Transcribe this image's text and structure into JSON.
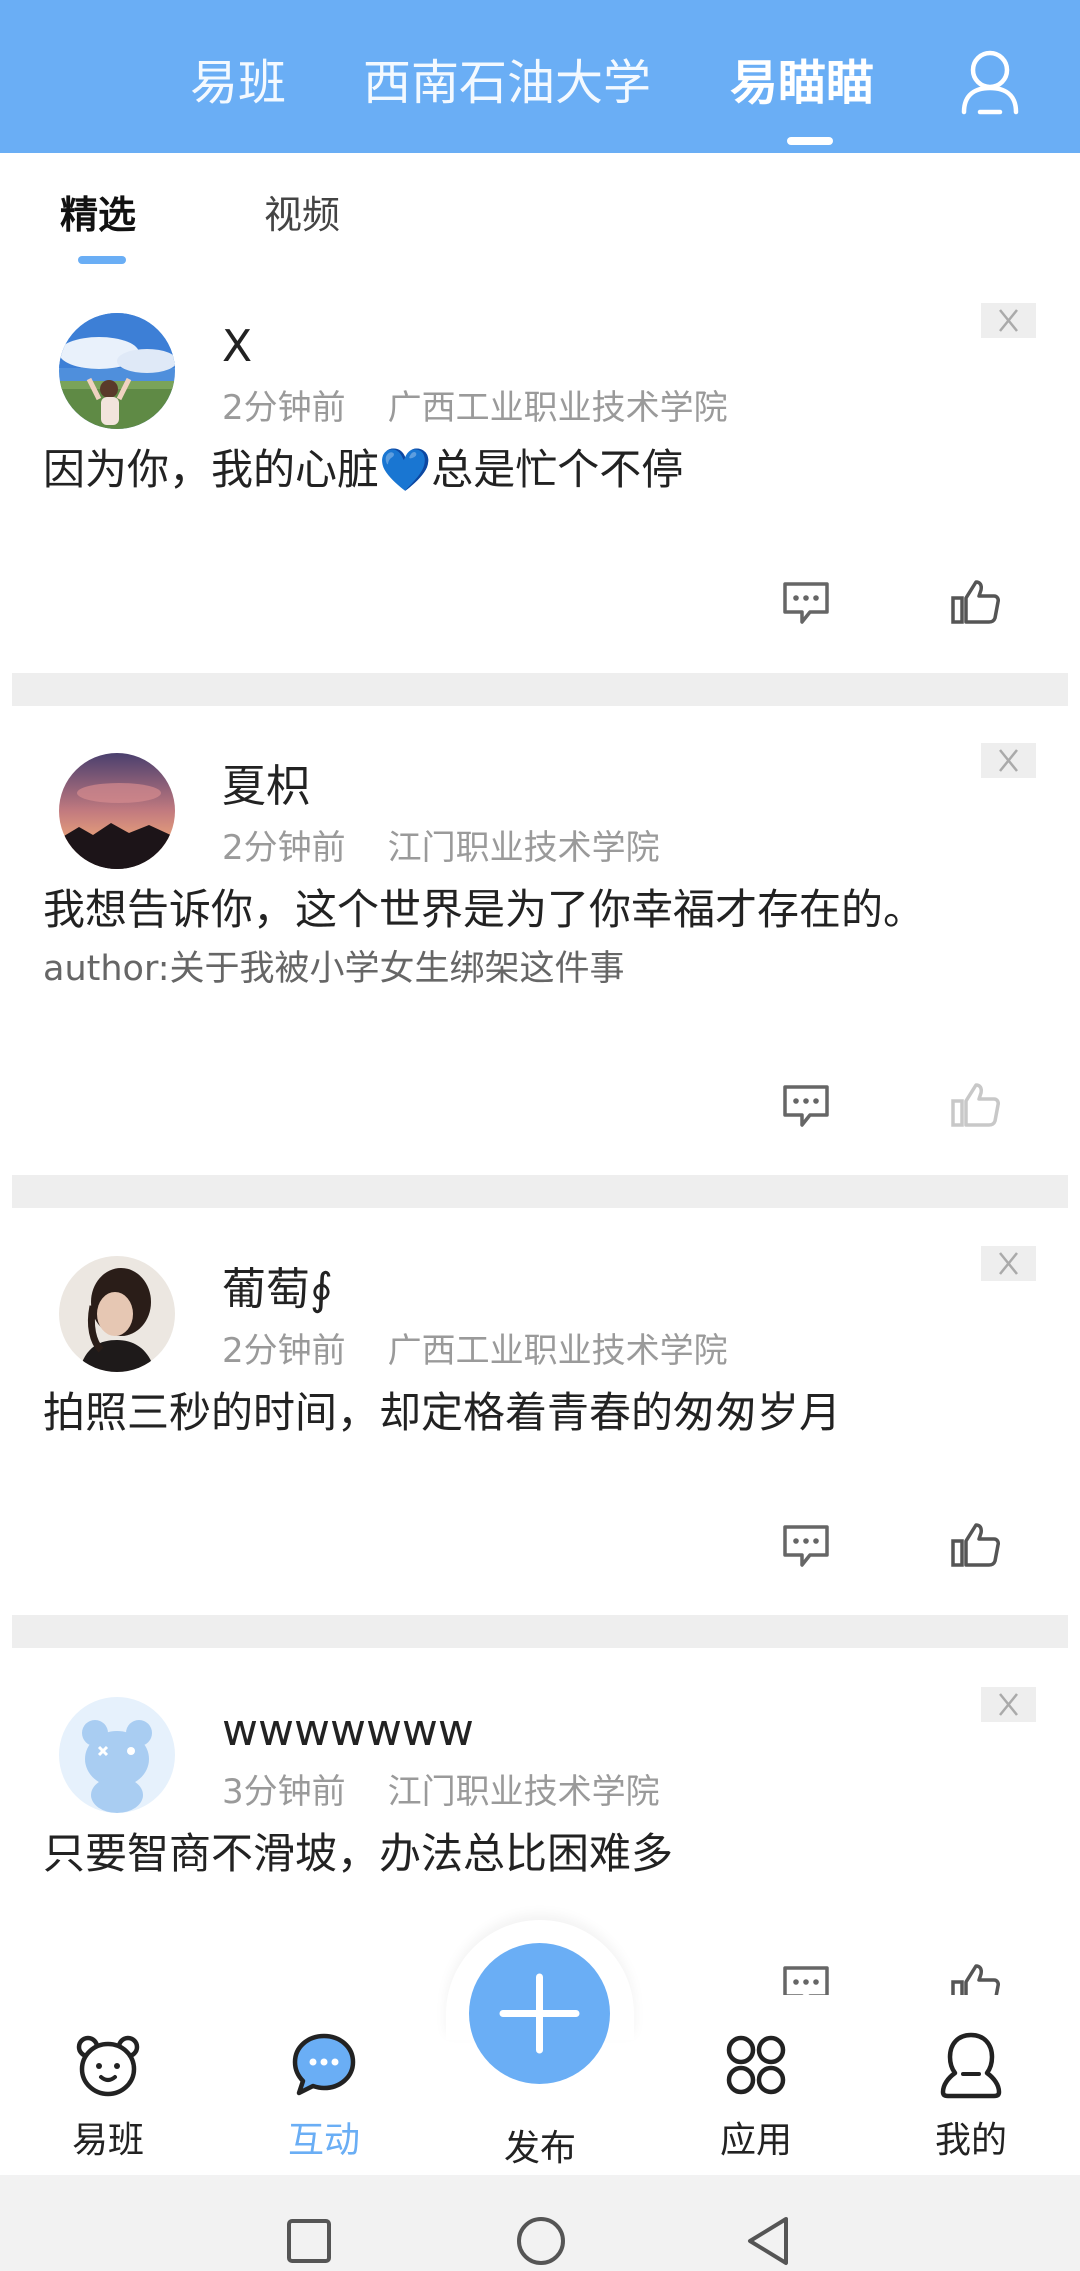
{
  "header": {
    "tabs": [
      {
        "label": "易班"
      },
      {
        "label": "西南石油大学"
      },
      {
        "label": "易瞄瞄"
      }
    ],
    "active_tab": "易瞄瞄",
    "user_icon": "user-icon"
  },
  "subtabs": [
    {
      "label": "精选"
    },
    {
      "label": "视频"
    }
  ],
  "posts": [
    {
      "username": "X",
      "time": "2分钟前",
      "school": "广西工业职业技术学院",
      "content": "因为你，我的心脏💙总是忙个不停",
      "author": "",
      "liked": false
    },
    {
      "username": "夏枳",
      "time": "2分钟前",
      "school": "江门职业技术学院",
      "content": "我想告诉你，这个世界是为了你幸福才存在的。",
      "author": "author:关于我被小学女生绑架这件事",
      "liked": false
    },
    {
      "username": "葡萄∮",
      "time": "2分钟前",
      "school": "广西工业职业技术学院",
      "content": "拍照三秒的时间，却定格着青春的匆匆岁月",
      "author": "",
      "liked": false
    },
    {
      "username": "wwwwwww",
      "time": "3分钟前",
      "school": "江门职业技术学院",
      "content": "只要智商不滑坡，办法总比困难多",
      "author": "",
      "liked": false
    }
  ],
  "bottom_nav": {
    "items": [
      {
        "label": "易班",
        "icon": "bear-icon"
      },
      {
        "label": "互动",
        "icon": "chat-bubble-icon"
      },
      {
        "label": "发布",
        "icon": "plus-icon"
      },
      {
        "label": "应用",
        "icon": "apps-icon"
      },
      {
        "label": "我的",
        "icon": "profile-icon"
      }
    ],
    "active": "互动"
  },
  "colors": {
    "accent": "#6aaef5",
    "separator": "#eeeeee",
    "meta_text": "#9a9a9a"
  }
}
